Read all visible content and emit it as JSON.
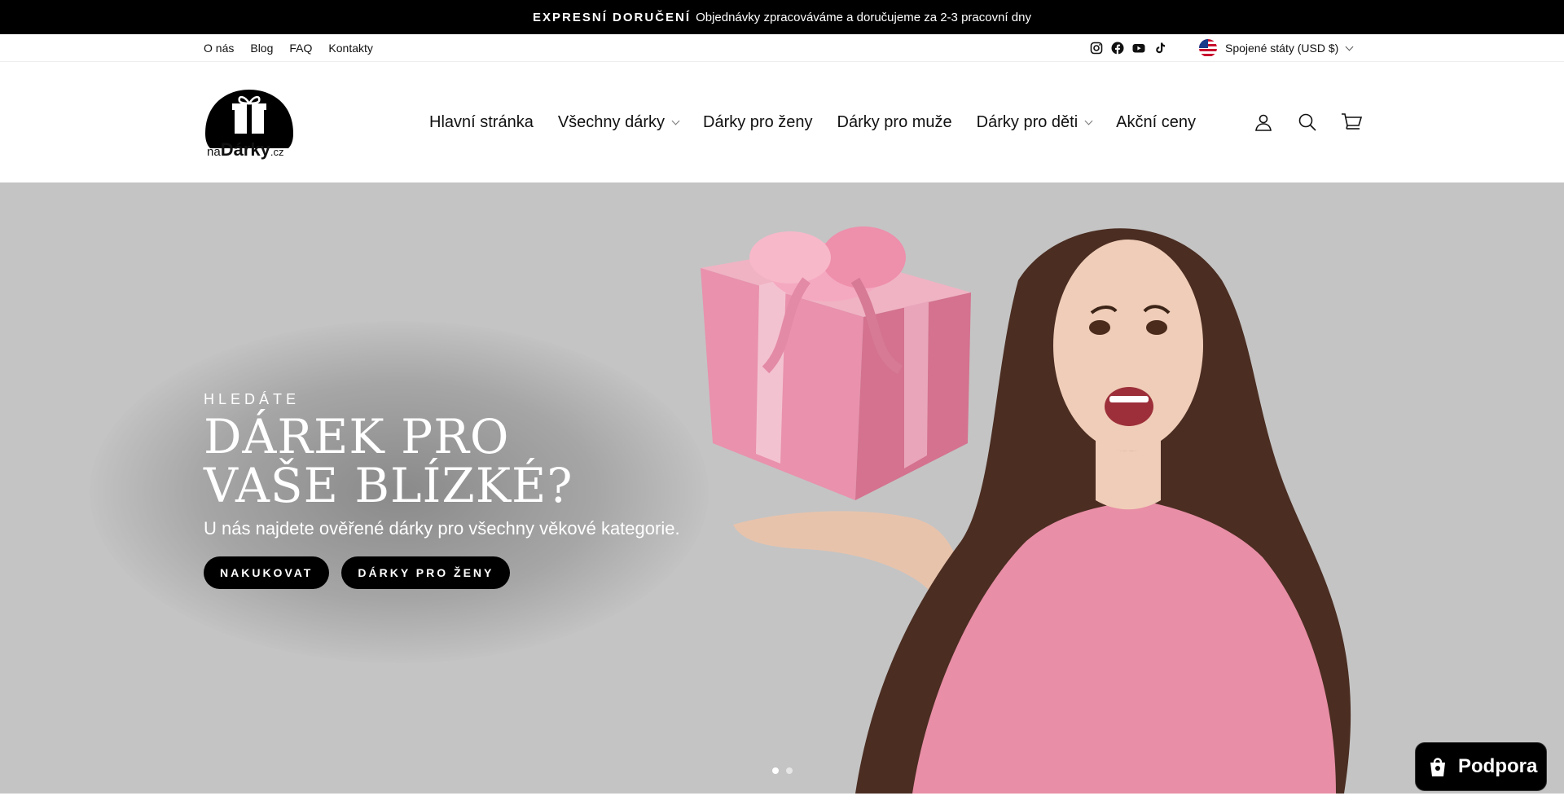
{
  "announcement": {
    "bold": "EXPRESNÍ DORUČENÍ",
    "text": "Objednávky zpracováváme a doručujeme za 2-3 pracovní dny"
  },
  "utility_nav": {
    "links": [
      "O nás",
      "Blog",
      "FAQ",
      "Kontakty"
    ],
    "socials": [
      "instagram-icon",
      "facebook-icon",
      "youtube-icon",
      "tiktok-icon"
    ],
    "currency": "Spojené státy (USD $)"
  },
  "logo": {
    "prefix": "na",
    "name": "Dárky",
    "suffix": ".cz"
  },
  "main_nav": {
    "items": [
      {
        "label": "Hlavní stránka",
        "dropdown": false
      },
      {
        "label": "Všechny dárky",
        "dropdown": true
      },
      {
        "label": "Dárky pro ženy",
        "dropdown": false
      },
      {
        "label": "Dárky pro muže",
        "dropdown": false
      },
      {
        "label": "Dárky pro děti",
        "dropdown": true
      },
      {
        "label": "Akční ceny",
        "dropdown": false
      }
    ],
    "icons": [
      "account-icon",
      "search-icon",
      "cart-icon"
    ]
  },
  "hero": {
    "kicker": "HLEDÁTE",
    "headline_line1": "DÁREK PRO",
    "headline_line2": "VAŠE BLÍZKÉ?",
    "subline": "U nás najdete ověřené dárky pro všechny věkové kategorie.",
    "cta_primary": "NAKUKOVAT",
    "cta_secondary": "DÁRKY PRO ŽENY",
    "slide_count": 2,
    "active_slide": 1,
    "background": "#c4c4c4"
  },
  "support_widget": {
    "label": "Podpora"
  }
}
